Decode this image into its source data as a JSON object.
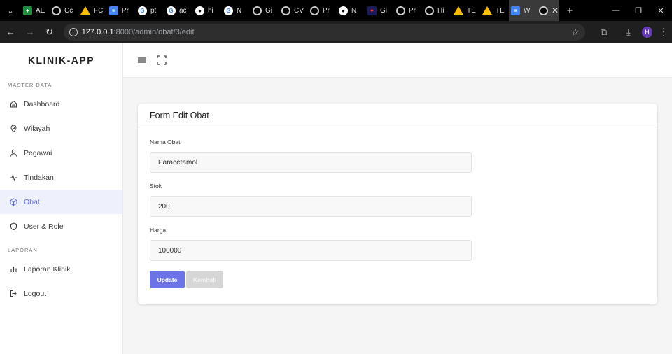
{
  "browser": {
    "tabs": [
      {
        "icon": "google-sheets-icon",
        "label": "AE",
        "cls": "fav-sheet",
        "glyph": "+"
      },
      {
        "icon": "globe-icon",
        "label": "Cc",
        "cls": "fav-globe",
        "glyph": ""
      },
      {
        "icon": "google-drive-icon",
        "label": "FC",
        "cls": "fav-drive",
        "glyph": ""
      },
      {
        "icon": "google-docs-icon",
        "label": "Pr",
        "cls": "fav-doc",
        "glyph": "≡"
      },
      {
        "icon": "google-icon",
        "label": "pt",
        "cls": "fav-google",
        "glyph": "G"
      },
      {
        "icon": "google-icon",
        "label": "ac",
        "cls": "fav-google",
        "glyph": "G"
      },
      {
        "icon": "github-icon",
        "label": "hi",
        "cls": "fav-gh",
        "glyph": "●"
      },
      {
        "icon": "google-icon",
        "label": "N",
        "cls": "fav-google",
        "glyph": "G"
      },
      {
        "icon": "globe-icon",
        "label": "Gi",
        "cls": "fav-globe",
        "glyph": ""
      },
      {
        "icon": "globe-icon",
        "label": "CV",
        "cls": "fav-globe",
        "glyph": ""
      },
      {
        "icon": "globe-icon",
        "label": "Pr",
        "cls": "fav-globe",
        "glyph": ""
      },
      {
        "icon": "github-icon",
        "label": "N",
        "cls": "fav-gh",
        "glyph": "●"
      },
      {
        "icon": "gemini-icon",
        "label": "Gi",
        "cls": "fav-comp",
        "glyph": "✦"
      },
      {
        "icon": "globe-icon",
        "label": "Pr",
        "cls": "fav-globe",
        "glyph": ""
      },
      {
        "icon": "globe-icon",
        "label": "Hi",
        "cls": "fav-globe",
        "glyph": ""
      },
      {
        "icon": "google-drive-icon",
        "label": "TE",
        "cls": "fav-drive",
        "glyph": ""
      },
      {
        "icon": "google-drive-icon",
        "label": "TE",
        "cls": "fav-drive",
        "glyph": ""
      },
      {
        "icon": "google-docs-icon",
        "label": "W",
        "cls": "fav-doc",
        "glyph": "≡"
      }
    ],
    "url_host": "127.0.0.1",
    "url_path": ":8000/admin/obat/3/edit",
    "profile_initial": "H"
  },
  "sidebar": {
    "brand": "KLINIK-APP",
    "section_master": "MASTER DATA",
    "items": [
      {
        "label": "Dashboard",
        "name": "sidebar-item-dashboard",
        "icon": "home-icon"
      },
      {
        "label": "Wilayah",
        "name": "sidebar-item-wilayah",
        "icon": "map-pin-icon"
      },
      {
        "label": "Pegawai",
        "name": "sidebar-item-pegawai",
        "icon": "user-icon"
      },
      {
        "label": "Tindakan",
        "name": "sidebar-item-tindakan",
        "icon": "activity-icon"
      },
      {
        "label": "Obat",
        "name": "sidebar-item-obat",
        "icon": "box-icon"
      },
      {
        "label": "User & Role",
        "name": "sidebar-item-user-role",
        "icon": "shield-icon"
      }
    ],
    "section_laporan": "LAPORAN",
    "laporan_items": [
      {
        "label": "Laporan Klinik",
        "name": "sidebar-item-laporan-klinik",
        "icon": "bar-chart-icon"
      },
      {
        "label": "Logout",
        "name": "sidebar-item-logout",
        "icon": "logout-icon"
      }
    ]
  },
  "form": {
    "title": "Form Edit Obat",
    "nama_label": "Nama Obat",
    "nama_value": "Paracetamol",
    "stok_label": "Stok",
    "stok_value": "200",
    "harga_label": "Harga",
    "harga_value": "100000",
    "update_label": "Update",
    "kembali_label": "Kembali"
  },
  "colors": {
    "accent": "#6c72e8",
    "active_bg": "#eef0fb",
    "active_text": "#5a67d8"
  }
}
